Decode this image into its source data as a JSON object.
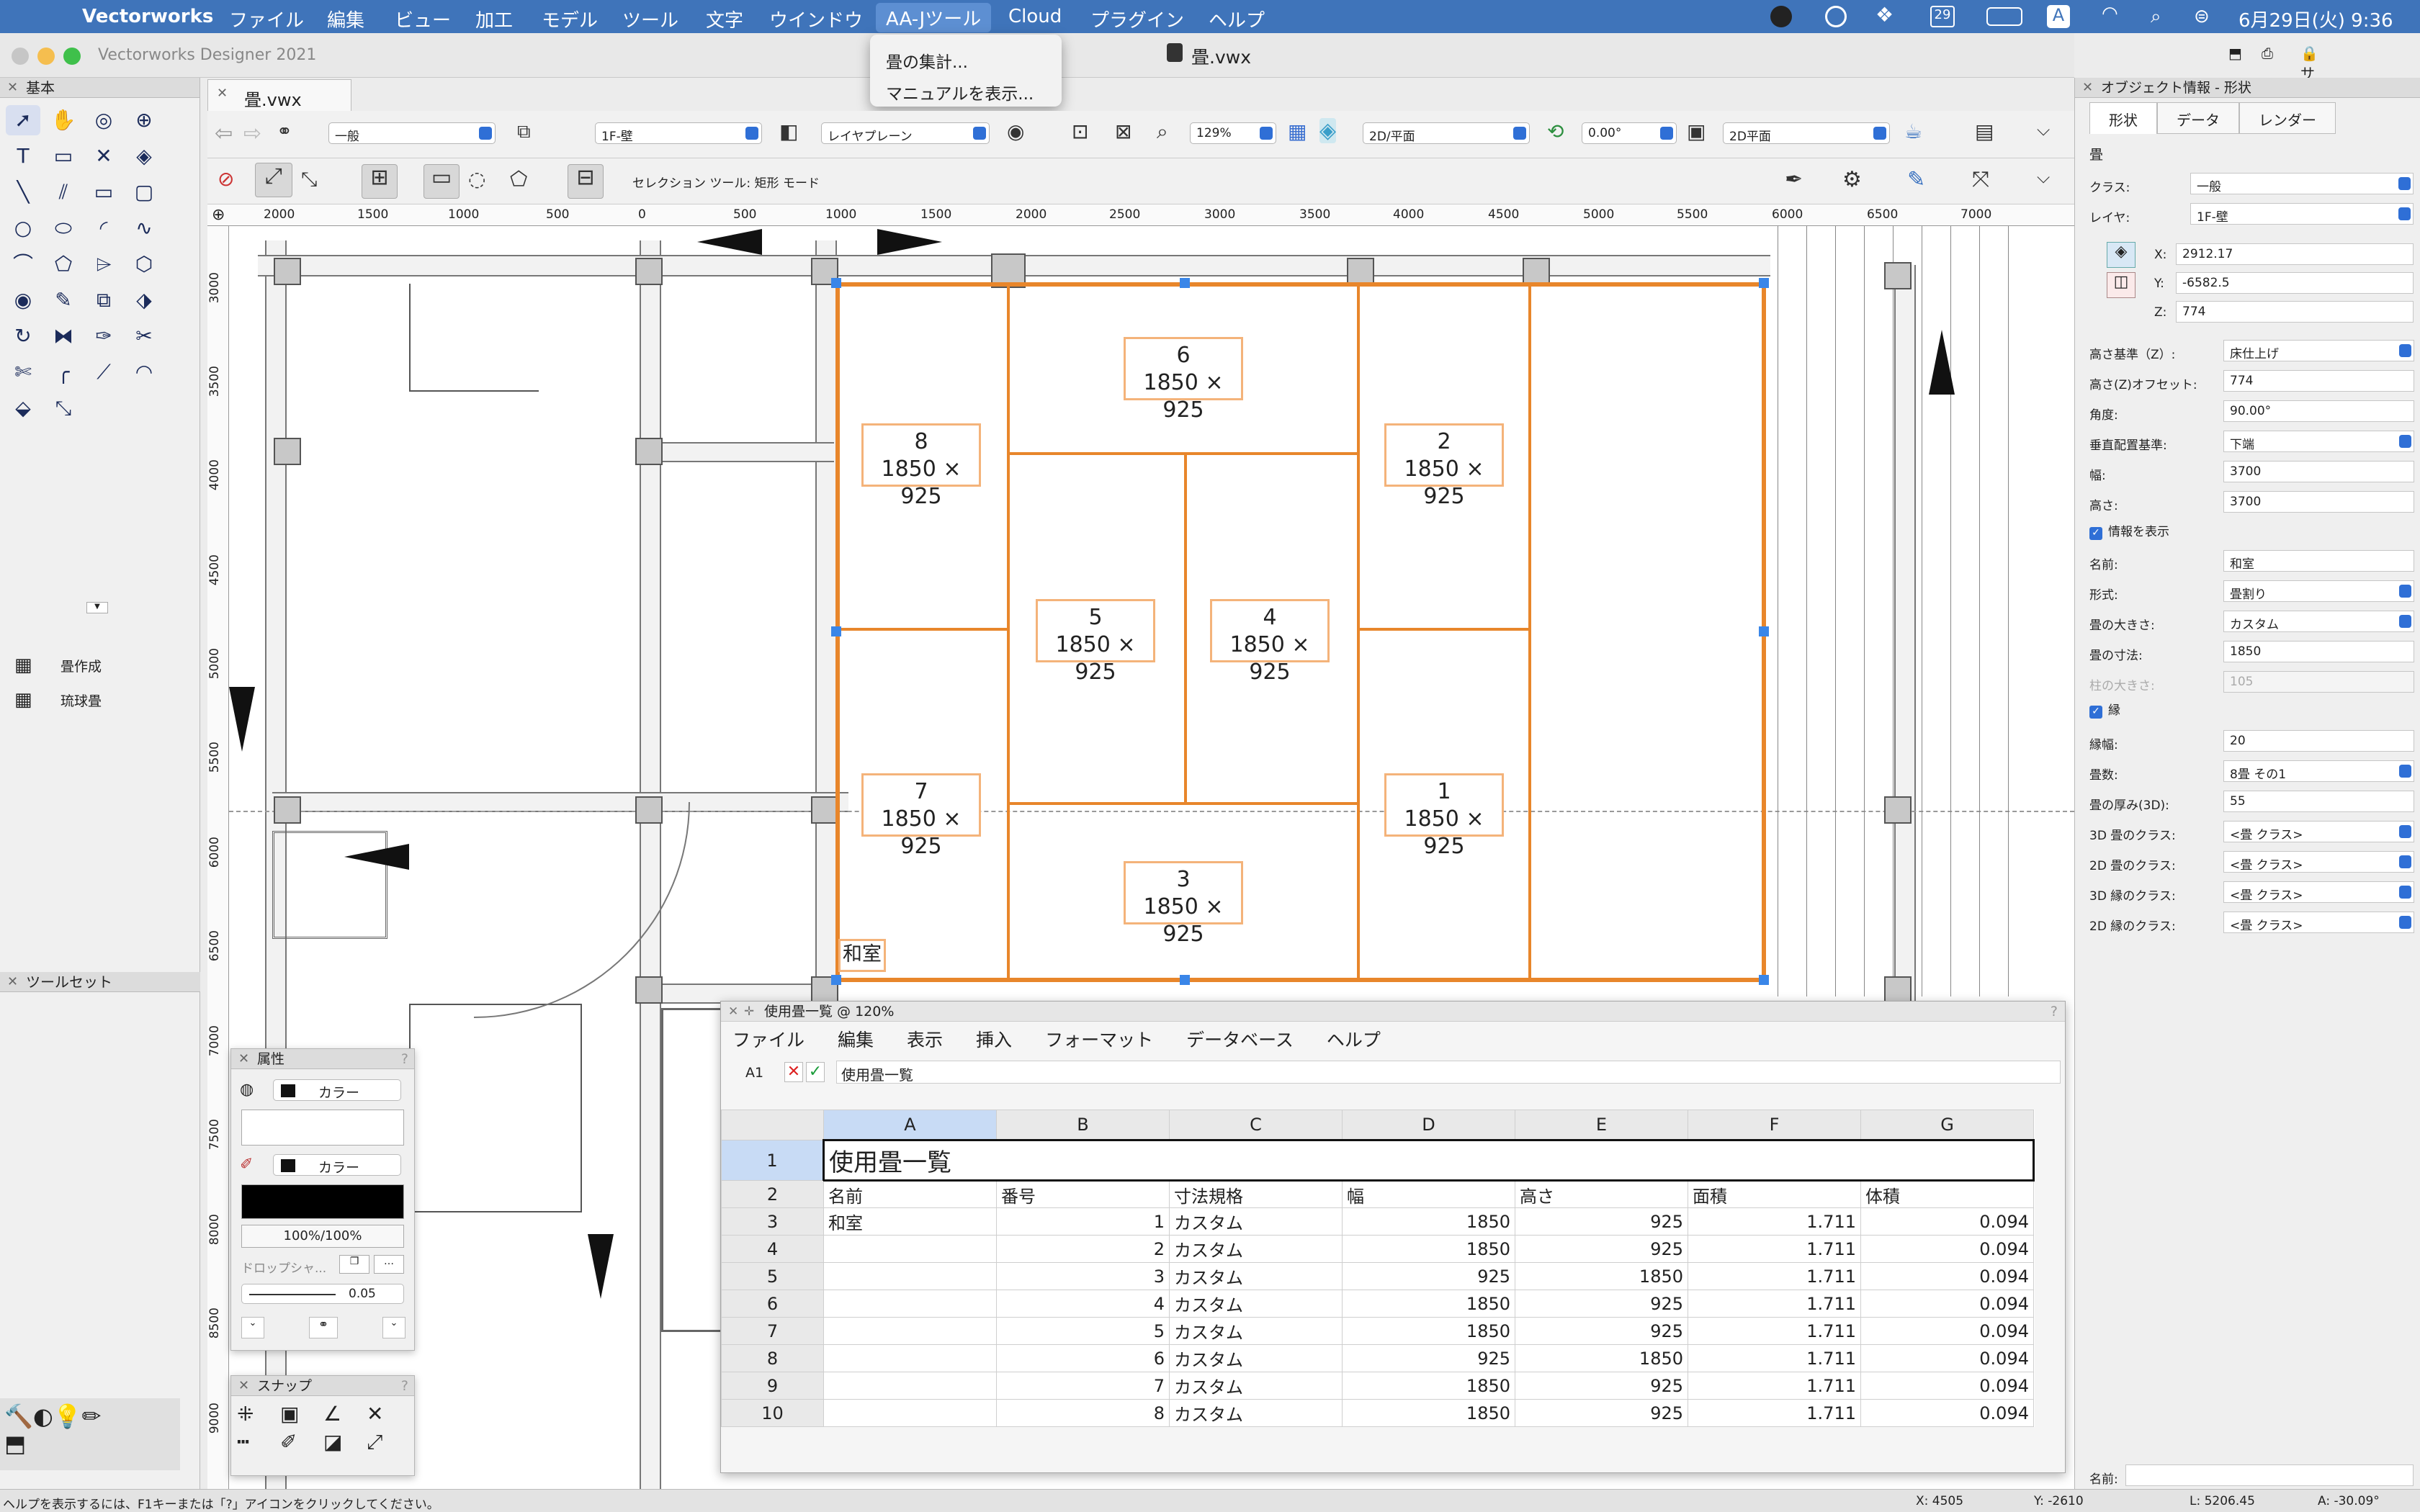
{
  "menubar": {
    "app": "Vectorworks",
    "items": [
      "ファイル",
      "編集",
      "ビュー",
      "加工",
      "モデル",
      "ツール",
      "文字",
      "ウインドウ",
      "AA-Jツール",
      "Cloud",
      "プラグイン",
      "ヘルプ"
    ],
    "active_item": "AA-Jツール",
    "calendar_badge": "29",
    "input_badge": "A",
    "clock": "6月29日(火) 9:36"
  },
  "dropdown": {
    "items": [
      "畳の集計...",
      "マニュアルを表示..."
    ]
  },
  "window": {
    "title": "Vectorworks Designer 2021",
    "doc_title": "畳.vwx",
    "signin": "サインイン"
  },
  "doc_tab": "畳.vwx",
  "palettes": {
    "basic": "基本",
    "toolsets": "ツールセット",
    "toolset_items": [
      {
        "icon": "tatami-grid-icon",
        "label": "畳作成"
      },
      {
        "icon": "ryukyu-grid-icon",
        "label": "琉球畳"
      }
    ],
    "attributes": "属性",
    "attr_fill": "カラー",
    "attr_pen": "カラー",
    "attr_opacity": "100%/100%",
    "attr_dropshadow": "ドロップシャ...",
    "attr_line": "0.05",
    "snap": "スナップ"
  },
  "toolbar": {
    "class": "一般",
    "layer": "1F-壁",
    "layer_plane": "レイヤプレーン",
    "zoom": "129%",
    "view": "2D/平面",
    "rotation": "0.00°",
    "render": "2D平面",
    "mode_label": "セレクション ツール: 矩形 モード"
  },
  "rulers": {
    "h": [
      "2000",
      "1500",
      "1000",
      "500",
      "0",
      "500",
      "1000",
      "1500",
      "2000",
      "2500",
      "3000",
      "3500",
      "4000",
      "4500",
      "5000",
      "5500",
      "6000",
      "6500",
      "7000"
    ],
    "v": [
      "3000",
      "3500",
      "4000",
      "4500",
      "5000",
      "5500",
      "6000",
      "6500",
      "7000",
      "7500",
      "8000",
      "8500",
      "9000"
    ]
  },
  "drawing": {
    "room_label": "和室",
    "mats": [
      {
        "no": "6",
        "size": "1850 × 925"
      },
      {
        "no": "8",
        "size": "1850 × 925"
      },
      {
        "no": "2",
        "size": "1850 × 925"
      },
      {
        "no": "5",
        "size": "1850 × 925"
      },
      {
        "no": "4",
        "size": "1850 × 925"
      },
      {
        "no": "7",
        "size": "1850 × 925"
      },
      {
        "no": "1",
        "size": "1850 × 925"
      },
      {
        "no": "3",
        "size": "1850 × 925"
      }
    ]
  },
  "object_info": {
    "title": "オブジェクト情報 - 形状",
    "tabs": [
      "形状",
      "データ",
      "レンダー"
    ],
    "object_type": "畳",
    "class": {
      "label": "クラス:",
      "value": "一般"
    },
    "layer": {
      "label": "レイヤ:",
      "value": "1F-壁"
    },
    "x": {
      "label": "X:",
      "value": "2912.17"
    },
    "y": {
      "label": "Y:",
      "value": "-6582.5"
    },
    "z": {
      "label": "Z:",
      "value": "774"
    },
    "fields": [
      {
        "label": "高さ基準（Z）:",
        "value": "床仕上げ",
        "dd": true
      },
      {
        "label": "高さ(Z)オフセット:",
        "value": "774"
      },
      {
        "label": "角度:",
        "value": "90.00°"
      },
      {
        "label": "垂直配置基準:",
        "value": "下端",
        "dd": true
      },
      {
        "label": "幅:",
        "value": "3700"
      },
      {
        "label": "高さ:",
        "value": "3700"
      }
    ],
    "show_info": "情報を表示",
    "fields2": [
      {
        "label": "名前:",
        "value": "和室"
      },
      {
        "label": "形式:",
        "value": "畳割り",
        "dd": true
      },
      {
        "label": "畳の大きさ:",
        "value": "カスタム",
        "dd": true
      },
      {
        "label": "畳の寸法:",
        "value": "1850"
      },
      {
        "label": "柱の大きさ:",
        "value": "105",
        "disabled": true
      }
    ],
    "border": "縁",
    "fields3": [
      {
        "label": "縁幅:",
        "value": "20"
      },
      {
        "label": "畳数:",
        "value": "8畳 その1",
        "dd": true
      },
      {
        "label": "畳の厚み(3D):",
        "value": "55"
      },
      {
        "label": "3D 畳のクラス:",
        "value": "<畳 クラス>",
        "dd": true
      },
      {
        "label": "2D 畳のクラス:",
        "value": "<畳 クラス>",
        "dd": true
      },
      {
        "label": "3D 縁のクラス:",
        "value": "<畳 クラス>",
        "dd": true
      },
      {
        "label": "2D 縁のクラス:",
        "value": "<畳 クラス>",
        "dd": true
      }
    ],
    "name_label": "名前:"
  },
  "worksheet": {
    "title": "使用畳一覧 @ 120%",
    "menu": [
      "ファイル",
      "編集",
      "表示",
      "挿入",
      "フォーマット",
      "データベース",
      "ヘルプ"
    ],
    "cell_ref": "A1",
    "formula": "使用畳一覧",
    "columns": [
      "A",
      "B",
      "C",
      "D",
      "E",
      "F",
      "G"
    ],
    "row_numbers": [
      "1",
      "2",
      "3",
      "4",
      "5",
      "6",
      "7",
      "8",
      "9",
      "10"
    ],
    "title_cell": "使用畳一覧",
    "headers": [
      "名前",
      "番号",
      "寸法規格",
      "幅",
      "高さ",
      "面積",
      "体積"
    ],
    "rows": [
      [
        "和室",
        "1",
        "カスタム",
        "1850",
        "925",
        "1.711",
        "0.094"
      ],
      [
        "",
        "2",
        "カスタム",
        "1850",
        "925",
        "1.711",
        "0.094"
      ],
      [
        "",
        "3",
        "カスタム",
        "925",
        "1850",
        "1.711",
        "0.094"
      ],
      [
        "",
        "4",
        "カスタム",
        "1850",
        "925",
        "1.711",
        "0.094"
      ],
      [
        "",
        "5",
        "カスタム",
        "1850",
        "925",
        "1.711",
        "0.094"
      ],
      [
        "",
        "6",
        "カスタム",
        "925",
        "1850",
        "1.711",
        "0.094"
      ],
      [
        "",
        "7",
        "カスタム",
        "1850",
        "925",
        "1.711",
        "0.094"
      ],
      [
        "",
        "8",
        "カスタム",
        "1850",
        "925",
        "1.711",
        "0.094"
      ]
    ]
  },
  "status": {
    "help": "ヘルプを表示するには、F1キーまたは「?」アイコンをクリックしてください。",
    "x": "X: 4505",
    "y": "Y: -2610",
    "l": "L: 5206.45",
    "a": "A: -30.09°"
  },
  "colors": {
    "menubar": "#3f74ba",
    "mat_stroke": "#e8862b",
    "tag_stroke": "#f4b37a",
    "handle": "#3a86e8",
    "accent": "#2f6fd6"
  }
}
